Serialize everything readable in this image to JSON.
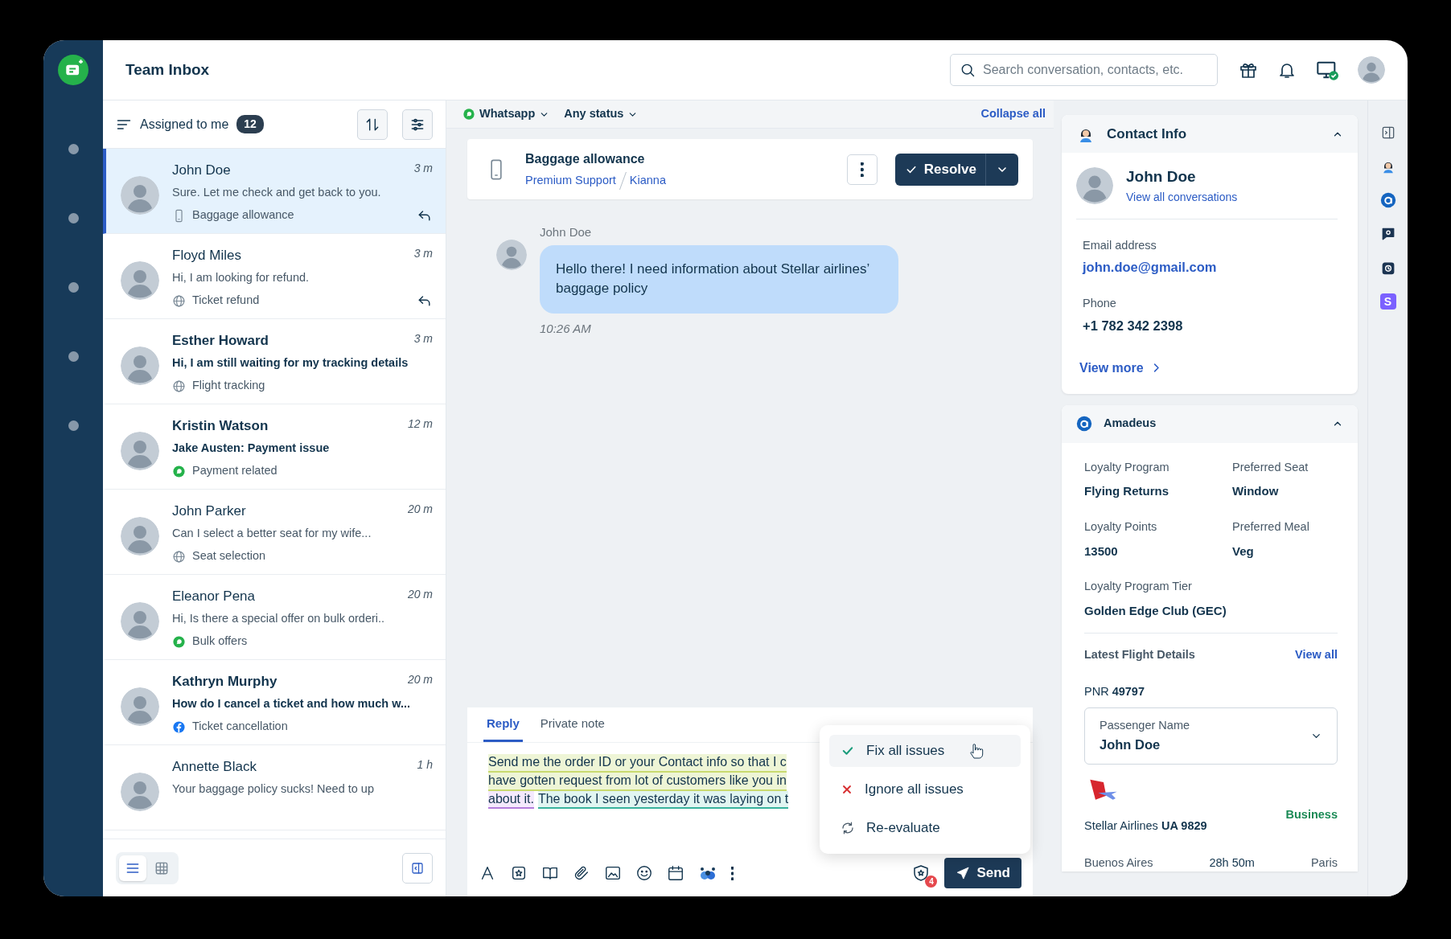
{
  "app": {
    "title": "Team Inbox"
  },
  "search": {
    "placeholder": "Search conversation, contacts, etc."
  },
  "list": {
    "title": "Assigned to me",
    "count": "12",
    "conversations": [
      {
        "name": "John Doe",
        "time": "3 m",
        "preview": "Sure. Let me check and get back to you.",
        "topic": "Baggage allowance",
        "kind": "phone",
        "unread": false,
        "replied": true,
        "selected": true
      },
      {
        "name": "Floyd Miles",
        "time": "3 m",
        "preview": "Hi, I am looking for refund.",
        "topic": "Ticket refund",
        "kind": "web",
        "unread": false,
        "replied": true,
        "selected": false
      },
      {
        "name": "Esther Howard",
        "time": "3 m",
        "preview": "Hi, I am still waiting for my tracking details",
        "topic": "Flight tracking",
        "kind": "web",
        "unread": true,
        "replied": false,
        "selected": false
      },
      {
        "name": "Kristin Watson",
        "time": "12 m",
        "preview": "Jake Austen: Payment issue",
        "topic": "Payment related",
        "kind": "whatsapp",
        "unread": true,
        "replied": false,
        "selected": false
      },
      {
        "name": "John Parker",
        "time": "20 m",
        "preview": "Can I select a better seat for my wife...",
        "topic": "Seat selection",
        "kind": "web",
        "unread": false,
        "replied": false,
        "selected": false
      },
      {
        "name": "Eleanor Pena",
        "time": "20 m",
        "preview": "Hi, Is there a special offer on bulk orderi..",
        "topic": "Bulk offers",
        "kind": "whatsapp",
        "unread": false,
        "replied": false,
        "selected": false
      },
      {
        "name": "Kathryn Murphy",
        "time": "20 m",
        "preview": "How do I cancel a ticket and how much w...",
        "topic": "Ticket cancellation",
        "kind": "facebook",
        "unread": true,
        "replied": false,
        "selected": false
      },
      {
        "name": "Annette Black",
        "time": "1 h",
        "preview": "Your baggage policy sucks! Need to up",
        "unread": false,
        "selected": false
      }
    ]
  },
  "view_toggle": [
    {
      "kind": "list",
      "selected": true
    },
    {
      "kind": "grid",
      "selected": false
    }
  ],
  "filters": [
    {
      "label": "Whatsapp",
      "kind": "channel"
    },
    {
      "label": "Any status",
      "kind": "status"
    }
  ],
  "collapse_label": "Collapse all",
  "ticket": {
    "subject": "Baggage allowance",
    "group": "Premium Support",
    "agent": "Kianna",
    "action": "Resolve"
  },
  "messages": [
    {
      "author": "John Doe",
      "text": "Hello there! I need information about Stellar airlines’ baggage policy",
      "time": "10:26 AM"
    }
  ],
  "compose": {
    "tabs": [
      {
        "label": "Reply",
        "selected": true
      },
      {
        "label": "Private note",
        "selected": false
      }
    ],
    "lines": [
      [
        {
          "text": "Send me the order ID or your Contact info so that I c",
          "kind": "grammar"
        }
      ],
      [
        {
          "text": "have gotten request from lot of customers like you in",
          "kind": "grammar"
        }
      ],
      [
        {
          "text": "about it.",
          "kind": "tone"
        },
        {
          "text": "The book I seen yesterday it was laying on t",
          "kind": "clarity"
        }
      ]
    ],
    "issue_count": "4",
    "send": "Send",
    "menu": [
      {
        "label": "Fix all issues",
        "kind": "fix",
        "selected": true
      },
      {
        "label": "Ignore all issues",
        "kind": "ignore",
        "selected": false
      },
      {
        "label": "Re-evaluate",
        "kind": "reevaluate",
        "selected": false
      }
    ]
  },
  "contact": {
    "section": "Contact Info",
    "expanded": true,
    "name": "John Doe",
    "link": "View all conversations",
    "fields": [
      {
        "label": "Email address",
        "value": "john.doe@gmail.com",
        "kind": "link"
      },
      {
        "label": "Phone",
        "value": "+1 782 342 2398",
        "kind": "text"
      }
    ],
    "more": "View more"
  },
  "amadeus": {
    "section": "Amadeus",
    "expanded": true,
    "fields": [
      {
        "label": "Loyalty Program",
        "value": "Flying Returns"
      },
      {
        "label": "Preferred Seat",
        "value": "Window"
      },
      {
        "label": "Loyalty Points",
        "value": "13500"
      },
      {
        "label": "Preferred Meal",
        "value": "Veg"
      },
      {
        "label": "Loyalty Program Tier",
        "value": "Golden Edge Club (GEC)"
      }
    ],
    "flights_label": "Latest Flight Details",
    "view_all": "View all",
    "pnr": "PNR **49797**",
    "passenger": {
      "label": "Passenger Name",
      "value": "John Doe"
    },
    "airline": "Stellar Airlines **UA 9829**",
    "cabin": "Business",
    "route": {
      "from": "Buenos Aires",
      "duration": "28h 50m",
      "to": "Paris"
    }
  },
  "right_rail": {
    "app_badge": "S"
  }
}
